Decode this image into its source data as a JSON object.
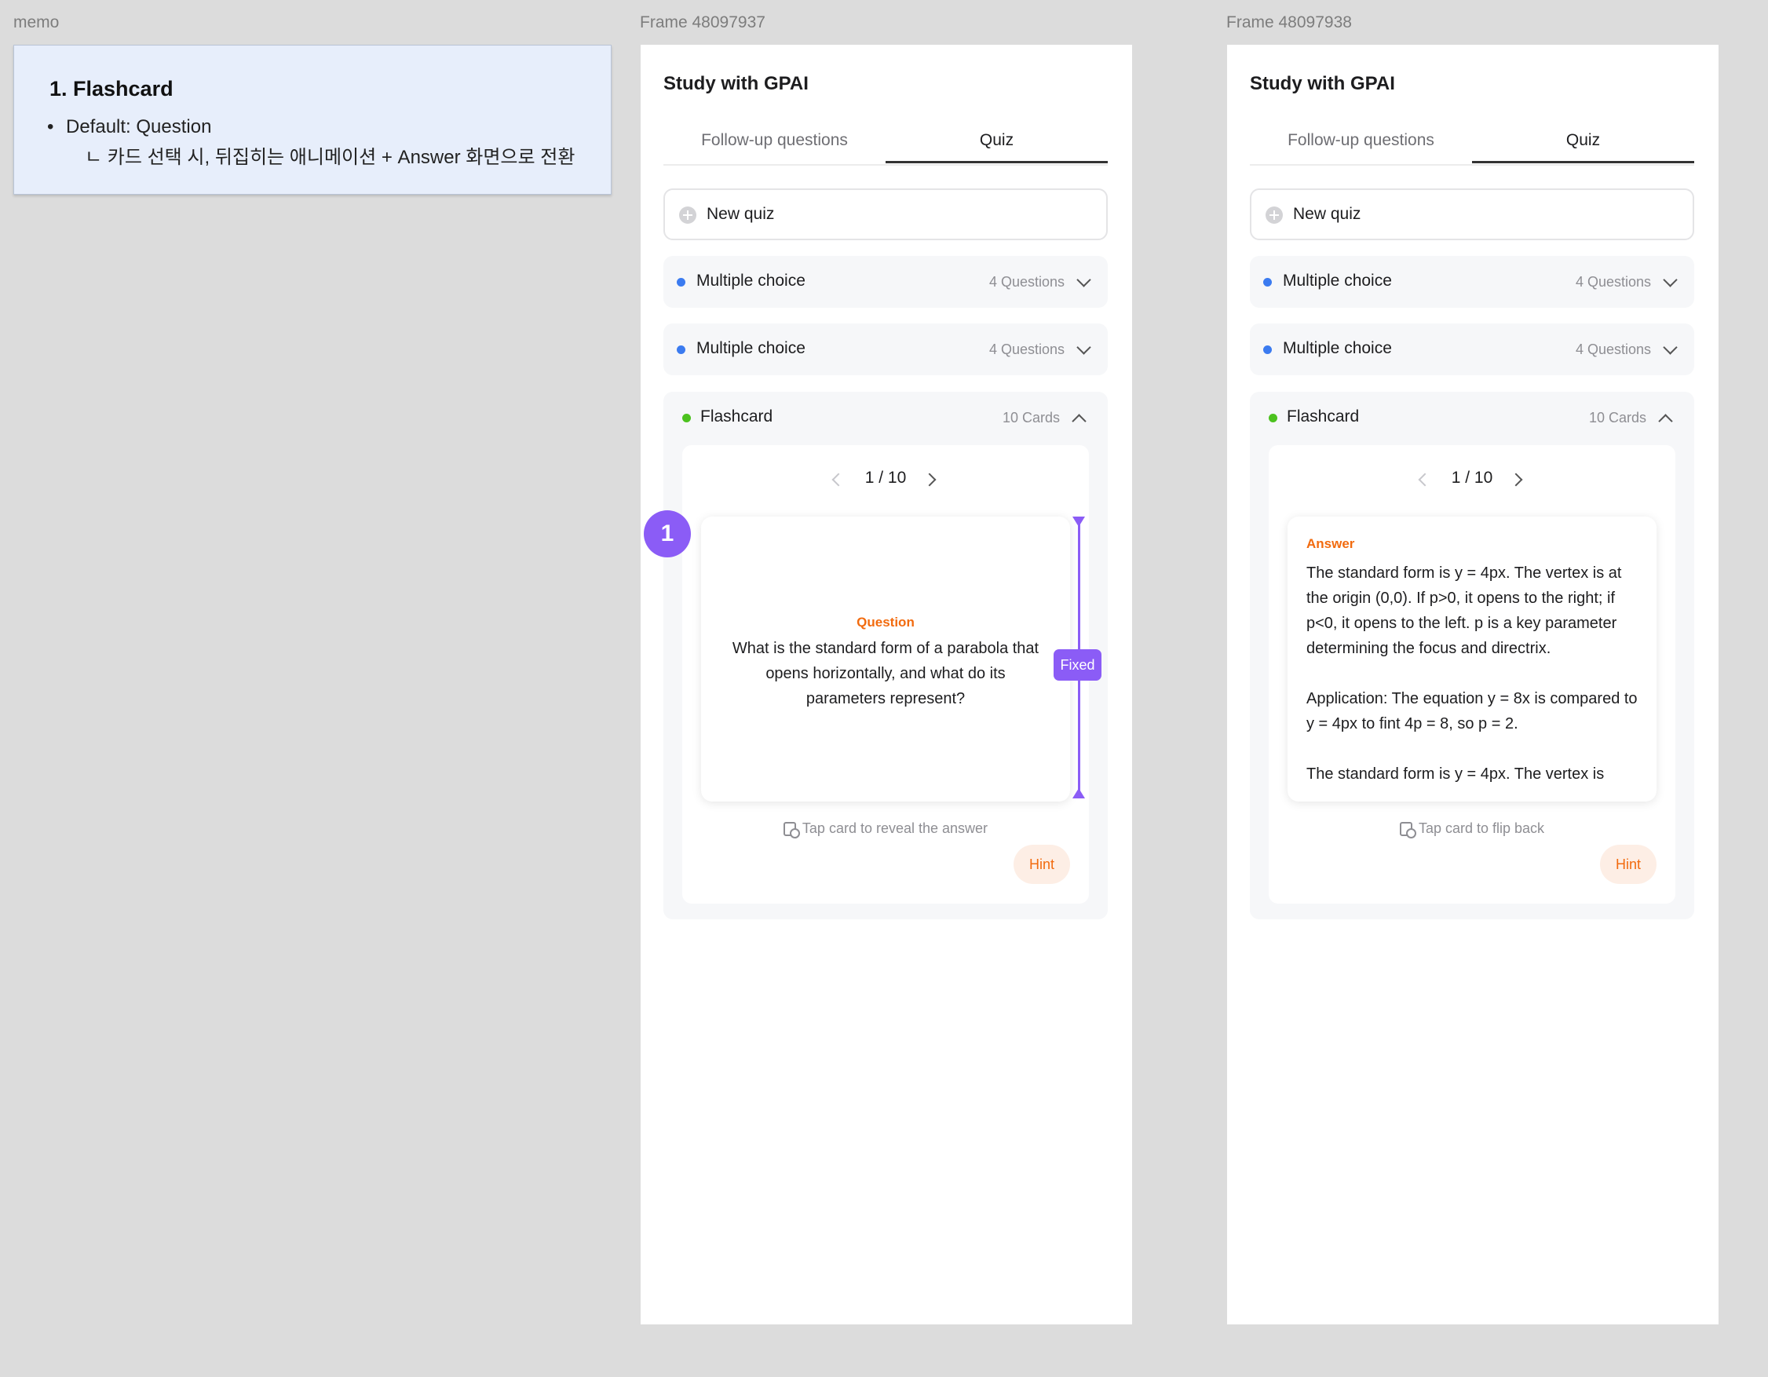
{
  "labels": {
    "memo": "memo",
    "frame1": "Frame 48097937",
    "frame2": "Frame 48097938"
  },
  "memo": {
    "title": "1. Flashcard",
    "line1": "Default: Question",
    "line2": "ㄴ 카드 선택 시, 뒤집히는 애니메이션 + Answer 화면으로 전환"
  },
  "app": {
    "title": "Study with GPAI",
    "tabs": [
      "Follow-up questions",
      "Quiz"
    ],
    "new_quiz": "New quiz",
    "rows": [
      {
        "label": "Multiple choice",
        "count": "4 Questions"
      },
      {
        "label": "Multiple choice",
        "count": "4 Questions"
      }
    ],
    "flashcard": {
      "label": "Flashcard",
      "count": "10 Cards",
      "pager": "1 / 10"
    },
    "hint": "Hint"
  },
  "front": {
    "label": "Question",
    "text": "What is the standard form of a parabola that opens horizontally, and what do its parameters represent?",
    "tap": "Tap card to reveal the answer"
  },
  "back": {
    "label": "Answer",
    "text": "The standard form is y = 4px. The vertex  is at the origin (0,0). If p>0, it opens to the right; if p<0, it opens to the left. p is a key parameter determining the focus and directrix.\n\nApplication: The equation y = 8x is compared to y = 4px to fint 4p = 8, so p = 2.\n\nThe standard form is y = 4px. The vertex  is",
    "tap": "Tap card to flip back"
  },
  "annotation": {
    "number": "1",
    "tag": "Fixed"
  },
  "colors": {
    "blue_dot": "#3b7bf0",
    "green_dot": "#4cc21f",
    "accent": "#f26b0f",
    "annotation": "#8b5cf6"
  }
}
